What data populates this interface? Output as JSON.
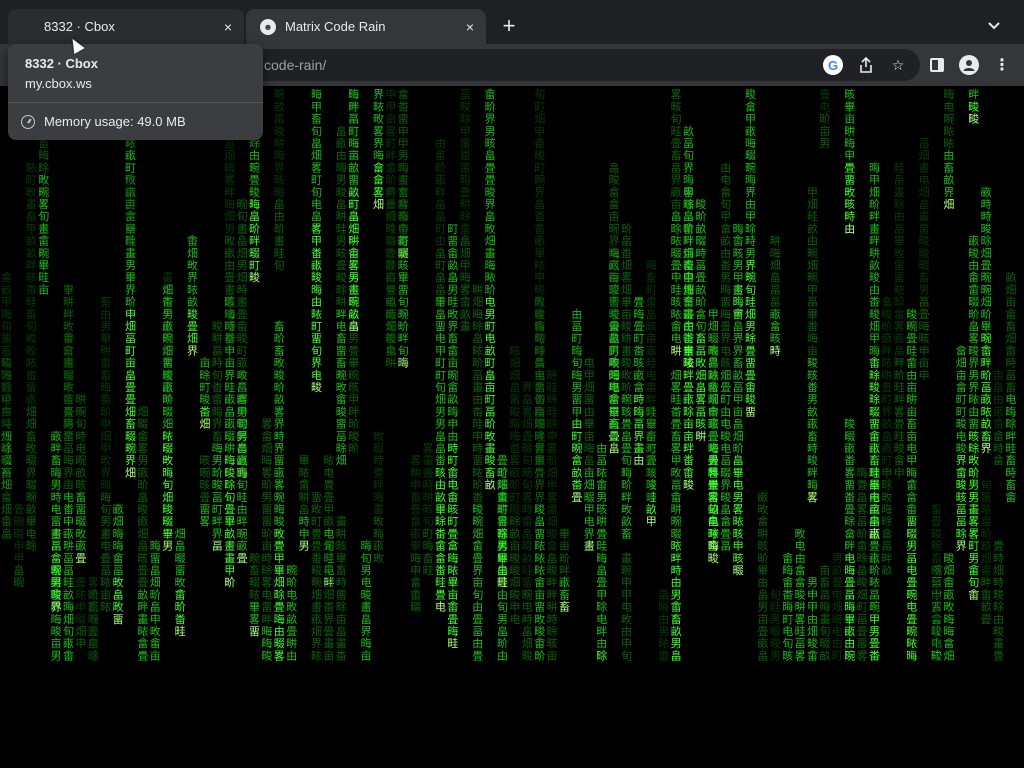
{
  "tabs": [
    {
      "title": "8332 · Cbox",
      "active": false
    },
    {
      "title": "Matrix Code Rain",
      "active": true
    }
  ],
  "toolbar": {
    "url_visible": "code-rain/"
  },
  "hovercard": {
    "title": "8332 · Cbox",
    "domain": "my.cbox.ws",
    "memory": "Memory usage: 49.0 MB"
  },
  "icons": {
    "close": "×",
    "newtab": "+",
    "tabsearch": "⌄",
    "google": "G",
    "share": "⇪",
    "star": "☆",
    "profile": "●",
    "menu": "⋮"
  },
  "rain": {
    "chars": "男界由甲申电畑畠畳町畦畔畝畍畋畊畐畑畜畞畠畡畢畣畤畧畨畩畭畯畹畷畳畲畱畮畬畫畯旬亩晦",
    "colors": {
      "head": "#a8ff7a",
      "bright": "#3dff2a",
      "mid": "#1fb81a",
      "dim": "#0e5f0b",
      "faint": "#073806"
    }
  }
}
